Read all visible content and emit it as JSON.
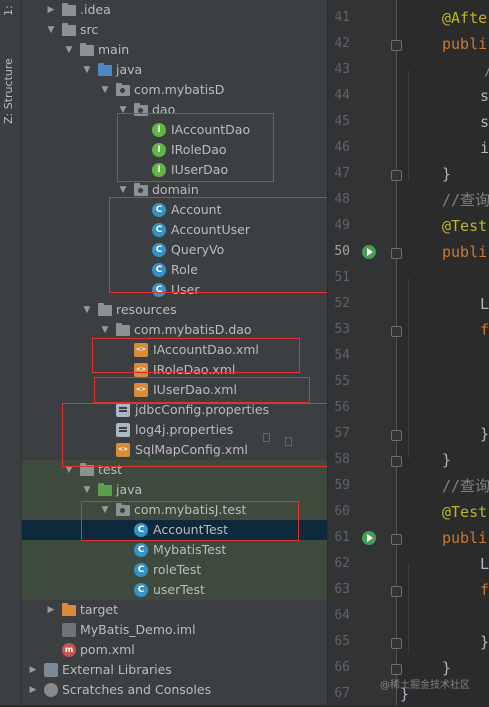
{
  "side_tabs": {
    "top": "1:",
    "structure": "Z: Structure"
  },
  "tree": {
    "rows": [
      {
        "label": ".idea",
        "icon": "folder-icon"
      },
      {
        "label": "src",
        "icon": "folder-icon"
      },
      {
        "label": "main",
        "icon": "folder-icon"
      },
      {
        "label": "java",
        "icon": "source-folder-icon"
      },
      {
        "label": "com.mybatisD",
        "icon": "package-icon"
      },
      {
        "label": "dao",
        "icon": "package-icon"
      },
      {
        "label": "IAccountDao",
        "icon": "interface-icon"
      },
      {
        "label": "IRoleDao",
        "icon": "interface-icon"
      },
      {
        "label": "IUserDao",
        "icon": "interface-icon"
      },
      {
        "label": "domain",
        "icon": "package-icon"
      },
      {
        "label": "Account",
        "icon": "class-icon"
      },
      {
        "label": "AccountUser",
        "icon": "class-icon"
      },
      {
        "label": "QueryVo",
        "icon": "class-icon"
      },
      {
        "label": "Role",
        "icon": "class-icon"
      },
      {
        "label": "User",
        "icon": "class-icon"
      },
      {
        "label": "resources",
        "icon": "resources-folder-icon"
      },
      {
        "label": "com.mybatisD.dao",
        "icon": "folder-icon"
      },
      {
        "label": "IAccountDao.xml",
        "icon": "xml-file-icon"
      },
      {
        "label": "IRoleDao.xml",
        "icon": "xml-file-icon"
      },
      {
        "label": "IUserDao.xml",
        "icon": "xml-file-icon"
      },
      {
        "label": "jdbcConfig.properties",
        "icon": "properties-file-icon"
      },
      {
        "label": "log4j.properties",
        "icon": "properties-file-icon"
      },
      {
        "label": "SqlMapConfig.xml",
        "icon": "xml-file-icon"
      },
      {
        "label": "test",
        "icon": "folder-icon"
      },
      {
        "label": "java",
        "icon": "test-source-folder-icon"
      },
      {
        "label": "com.mybatisJ.test",
        "icon": "package-icon"
      },
      {
        "label": "AccountTest",
        "icon": "test-class-icon"
      },
      {
        "label": "MybatisTest",
        "icon": "test-class-icon"
      },
      {
        "label": "roleTest",
        "icon": "test-class-icon"
      },
      {
        "label": "userTest",
        "icon": "test-class-icon"
      },
      {
        "label": "target",
        "icon": "excluded-folder-icon"
      },
      {
        "label": "MyBatis_Demo.iml",
        "icon": "iml-file-icon"
      },
      {
        "label": "pom.xml",
        "icon": "maven-file-icon"
      },
      {
        "label": "External Libraries",
        "icon": "library-icon"
      },
      {
        "label": "Scratches and Consoles",
        "icon": "scratch-icon"
      }
    ]
  },
  "editor": {
    "line_numbers": [
      "41",
      "42",
      "43",
      "44",
      "45",
      "46",
      "47",
      "48",
      "49",
      "50",
      "51",
      "52",
      "53",
      "54",
      "55",
      "56",
      "57",
      "58",
      "59",
      "60",
      "61",
      "62",
      "63",
      "64",
      "65",
      "66",
      "67"
    ],
    "code": [
      {
        "text": "@Afte",
        "type": "annotation"
      },
      {
        "text": "publi",
        "type": "keyword"
      },
      {
        "text": "/",
        "type": "comment"
      },
      {
        "text": "s",
        "type": "plain"
      },
      {
        "text": "s",
        "type": "plain"
      },
      {
        "text": "i",
        "type": "plain"
      },
      {
        "text": "}",
        "type": "plain"
      },
      {
        "text": "//查询",
        "type": "comment"
      },
      {
        "text": "@Test",
        "type": "annotation"
      },
      {
        "text": "publi",
        "type": "keyword"
      },
      {
        "text": "",
        "type": "plain"
      },
      {
        "text": "L",
        "type": "plain"
      },
      {
        "text": "f",
        "type": "keyword"
      },
      {
        "text": "",
        "type": "plain"
      },
      {
        "text": "",
        "type": "plain"
      },
      {
        "text": "",
        "type": "plain"
      },
      {
        "text": "}",
        "type": "plain"
      },
      {
        "text": "}",
        "type": "plain"
      },
      {
        "text": "//查询",
        "type": "comment"
      },
      {
        "text": "@Test",
        "type": "annotation"
      },
      {
        "text": "publi",
        "type": "keyword"
      },
      {
        "text": "L",
        "type": "plain"
      },
      {
        "text": "f",
        "type": "keyword"
      },
      {
        "text": "",
        "type": "plain"
      },
      {
        "text": "}",
        "type": "plain"
      },
      {
        "text": "}",
        "type": "plain"
      },
      {
        "text": "}",
        "type": "plain"
      }
    ],
    "current_line": "50"
  },
  "watermark": "@稀土掘金技术社区",
  "colors": {
    "highlight_box": "#e0332f",
    "selection": "#0d293e",
    "test_background": "#3f4a3e",
    "annotation": "#bbb529",
    "keyword": "#cc7832",
    "comment": "#808080"
  }
}
